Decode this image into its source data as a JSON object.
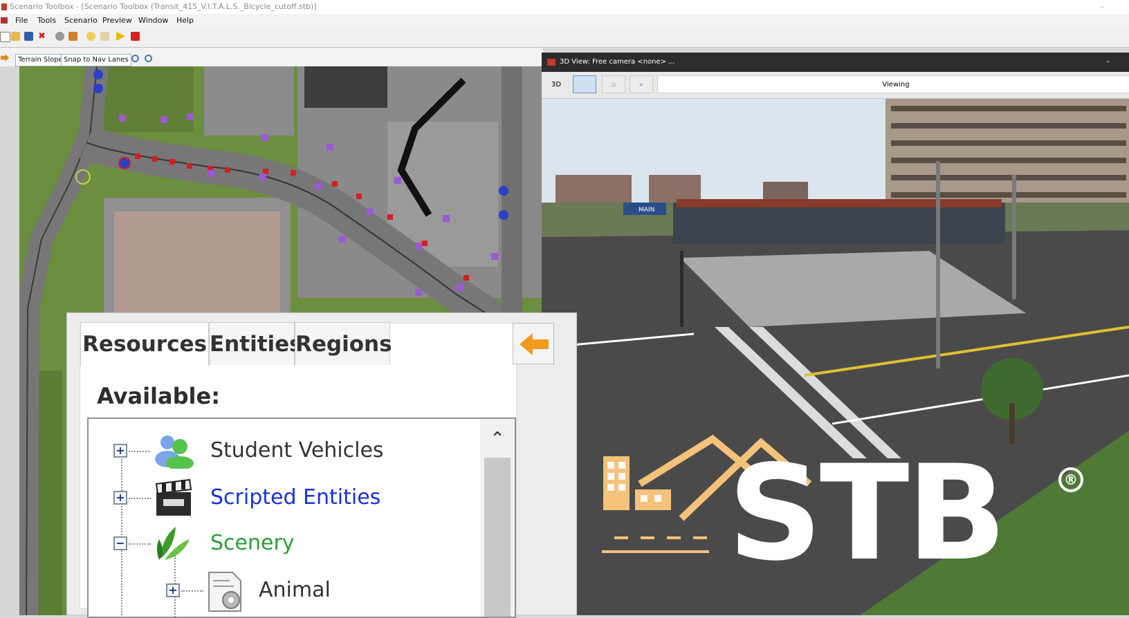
{
  "window": {
    "title": "Scenario Toolbox - [Scenario Toolbox (Transit_415_V.I.T.A.L.S._Bicycle_cutoff.stb)]"
  },
  "menubar": {
    "items": [
      "File",
      "Tools",
      "Scenario",
      "Preview",
      "Window",
      "Help"
    ]
  },
  "map_toolbar": {
    "terrain_slope": "Terrain Slope",
    "snap_to_nav_lanes": "Snap to Nav Lanes"
  },
  "view3d": {
    "title": "3D View: Free camera <none> ...",
    "btn_3d": "3D",
    "viewing": "Viewing",
    "sign_main": "MAIN"
  },
  "resources_panel": {
    "tabs": [
      "Resources",
      "Entities",
      "Regions"
    ],
    "active_tab": "Resources",
    "available_label": "Available:",
    "tree": [
      {
        "label": "Student Vehicles",
        "color": "#333333",
        "expanded": false,
        "icon": "users-icon"
      },
      {
        "label": "Scripted Entities",
        "color": "#1a2fd8",
        "expanded": false,
        "icon": "clapperboard-icon"
      },
      {
        "label": "Scenery",
        "color": "#2a9d3a",
        "expanded": true,
        "icon": "leaves-icon"
      },
      {
        "label": "Animal",
        "color": "#333333",
        "expanded": false,
        "icon": "document-gear-icon"
      }
    ]
  },
  "logo": {
    "text": "STB",
    "registered": "®",
    "colors": {
      "accent": "#f5c27a",
      "text": "#ffffff"
    }
  }
}
